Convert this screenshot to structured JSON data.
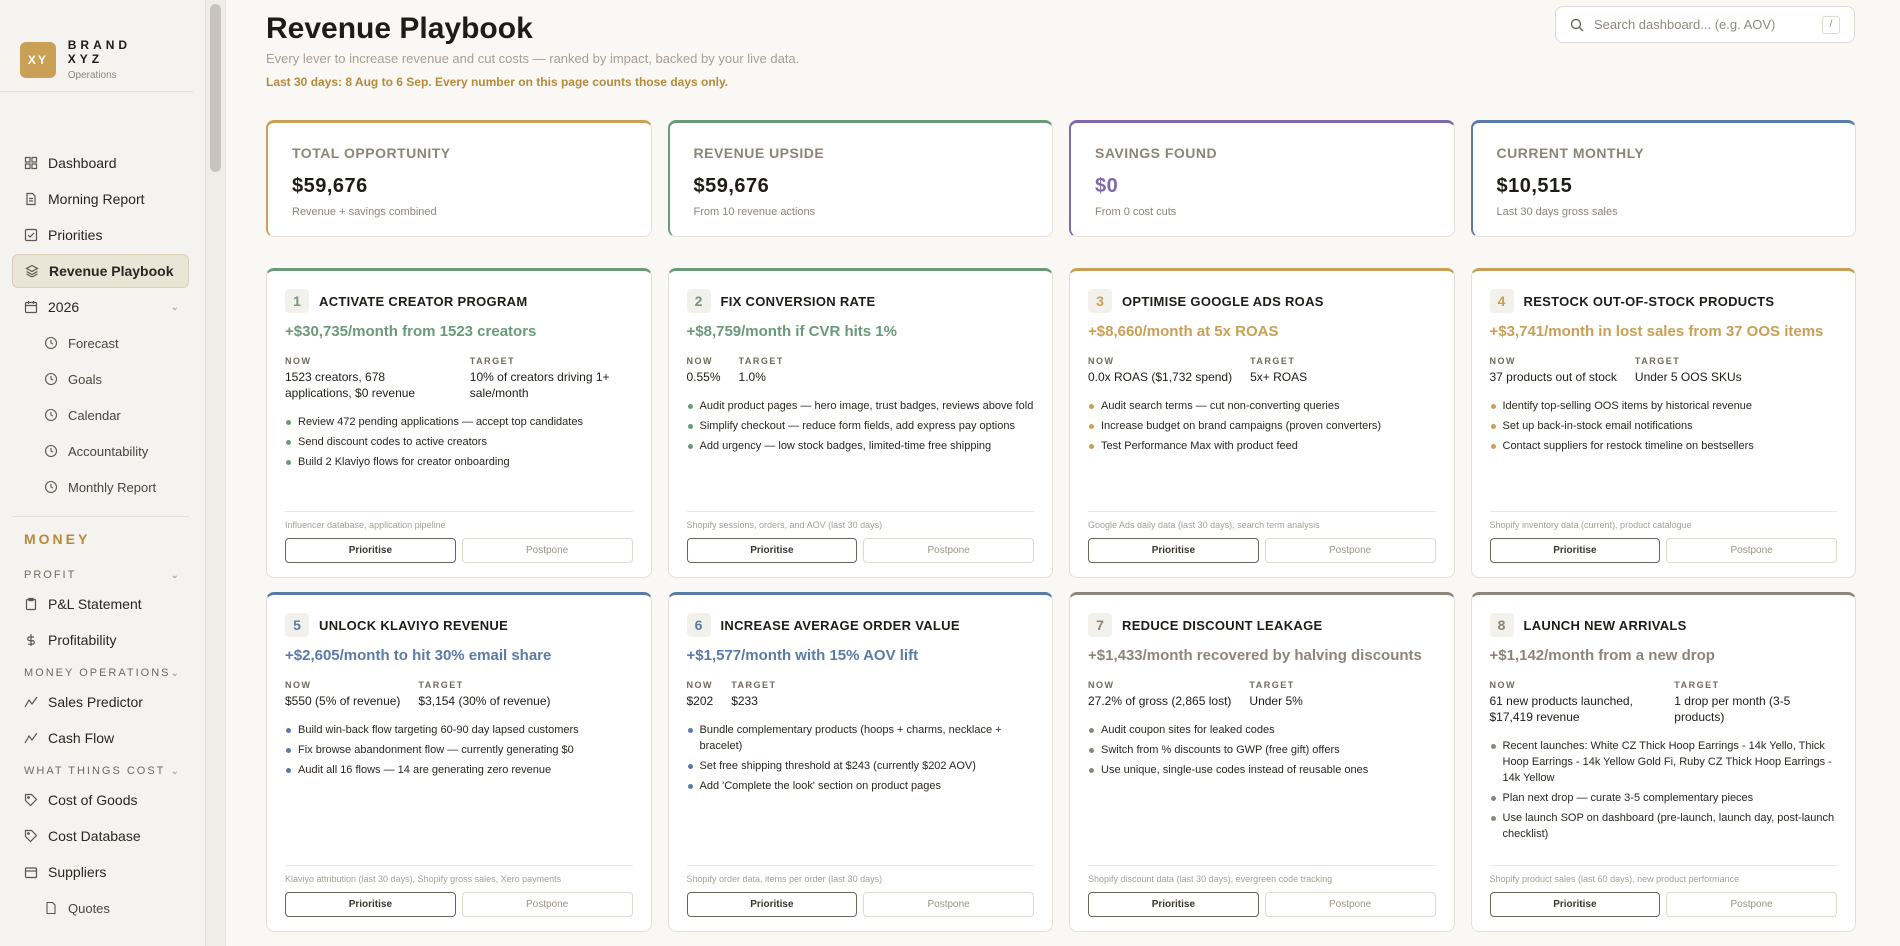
{
  "brand": {
    "logo": "XY",
    "name": "BRAND XYZ",
    "sub": "Operations"
  },
  "nav": [
    {
      "label": "Dashboard",
      "icon": "grid-icon"
    },
    {
      "label": "Morning Report",
      "icon": "document-icon"
    },
    {
      "label": "Priorities",
      "icon": "checklist-icon"
    },
    {
      "label": "Revenue Playbook",
      "icon": "layers-icon",
      "active": true
    },
    {
      "label": "2026",
      "icon": "calendar-icon",
      "expandable": true
    }
  ],
  "nav_sub": [
    {
      "label": "Forecast"
    },
    {
      "label": "Goals"
    },
    {
      "label": "Calendar"
    },
    {
      "label": "Accountability"
    },
    {
      "label": "Monthly Report"
    }
  ],
  "money": {
    "section": "MONEY",
    "groups": [
      {
        "title": "PROFIT",
        "items": [
          {
            "label": "P&L Statement",
            "icon": "clipboard-icon"
          },
          {
            "label": "Profitability",
            "icon": "dollar-icon"
          }
        ]
      },
      {
        "title": "MONEY OPERATIONS",
        "items": [
          {
            "label": "Sales Predictor",
            "icon": "trend-icon"
          },
          {
            "label": "Cash Flow",
            "icon": "trend-icon"
          }
        ]
      },
      {
        "title": "WHAT THINGS COST",
        "items": [
          {
            "label": "Cost of Goods",
            "icon": "tag-icon"
          },
          {
            "label": "Cost Database",
            "icon": "tag-icon"
          },
          {
            "label": "Suppliers",
            "icon": "box-icon"
          },
          {
            "label": "Quotes",
            "icon": "file-icon",
            "sub": true
          }
        ]
      }
    ]
  },
  "header": {
    "title": "Revenue Playbook",
    "subtitle": "Every lever to increase revenue and cut costs — ranked by impact, backed by your live data.",
    "note": "Last 30 days: 8 Aug to 6 Sep. Every number on this page counts those days only.",
    "search_placeholder": "Search dashboard... (e.g. AOV)",
    "search_shortcut": "/"
  },
  "stats": [
    {
      "label": "TOTAL OPPORTUNITY",
      "value": "$59,676",
      "hint": "Revenue + savings combined",
      "accent": "#c9a055",
      "value_color": "#1f1c17"
    },
    {
      "label": "REVENUE UPSIDE",
      "value": "$59,676",
      "hint": "From 10 revenue actions",
      "accent": "#6a9a7a",
      "value_color": "#1f1c17"
    },
    {
      "label": "SAVINGS FOUND",
      "value": "$0",
      "hint": "From 0 cost cuts",
      "accent": "#7d6aa8",
      "value_color": "#7d6aa8"
    },
    {
      "label": "CURRENT MONTHLY",
      "value": "$10,515",
      "hint": "Last 30 days gross sales",
      "accent": "#5a7aa8",
      "value_color": "#1f1c17"
    }
  ],
  "labels": {
    "now": "NOW",
    "target": "TARGET",
    "prioritise": "Prioritise",
    "postpone": "Postpone"
  },
  "levers": [
    {
      "num": "1",
      "title": "ACTIVATE CREATOR PROGRAM",
      "upside": "+$30,735/month from 1523 creators",
      "color": "#6a9a7a",
      "now": "1523 creators, 678 applications, $0 revenue",
      "target": "10% of creators driving 1+ sale/month",
      "actions": [
        "Review 472 pending applications — accept top candidates",
        "Send discount codes to active creators",
        "Build 2 Klaviyo flows for creator onboarding"
      ],
      "source": "Influencer database, application pipeline"
    },
    {
      "num": "2",
      "title": "FIX CONVERSION RATE",
      "upside": "+$8,759/month if CVR hits 1%",
      "color": "#6a9a7a",
      "now": "0.55%",
      "target": "1.0%",
      "actions": [
        "Audit product pages — hero image, trust badges, reviews above fold",
        "Simplify checkout — reduce form fields, add express pay options",
        "Add urgency — low stock badges, limited-time free shipping"
      ],
      "source": "Shopify sessions, orders, and AOV (last 30 days)"
    },
    {
      "num": "3",
      "title": "OPTIMISE GOOGLE ADS ROAS",
      "upside": "+$8,660/month at 5x ROAS",
      "color": "#c9a055",
      "now": "0.0x ROAS ($1,732 spend)",
      "target": "5x+ ROAS",
      "actions": [
        "Audit search terms — cut non-converting queries",
        "Increase budget on brand campaigns (proven converters)",
        "Test Performance Max with product feed"
      ],
      "source": "Google Ads daily data (last 30 days), search term analysis"
    },
    {
      "num": "4",
      "title": "RESTOCK OUT-OF-STOCK PRODUCTS",
      "upside": "+$3,741/month in lost sales from 37 OOS items",
      "color": "#c9a055",
      "now": "37 products out of stock",
      "target": "Under 5 OOS SKUs",
      "actions": [
        "Identify top-selling OOS items by historical revenue",
        "Set up back-in-stock email notifications",
        "Contact suppliers for restock timeline on bestsellers"
      ],
      "source": "Shopify inventory data (current), product catalogue"
    },
    {
      "num": "5",
      "title": "UNLOCK KLAVIYO REVENUE",
      "upside": "+$2,605/month to hit 30% email share",
      "color": "#5a7aa8",
      "now": "$550 (5% of revenue)",
      "target": "$3,154 (30% of revenue)",
      "actions": [
        "Build win-back flow targeting 60-90 day lapsed customers",
        "Fix browse abandonment flow — currently generating $0",
        "Audit all 16 flows — 14 are generating zero revenue"
      ],
      "source": "Klaviyo attribution (last 30 days), Shopify gross sales, Xero payments"
    },
    {
      "num": "6",
      "title": "INCREASE AVERAGE ORDER VALUE",
      "upside": "+$1,577/month with 15% AOV lift",
      "color": "#5a7aa8",
      "now": "$202",
      "target": "$233",
      "actions": [
        "Bundle complementary products (hoops + charms, necklace + bracelet)",
        "Set free shipping threshold at $243 (currently $202 AOV)",
        "Add 'Complete the look' section on product pages"
      ],
      "source": "Shopify order data, items per order (last 30 days)"
    },
    {
      "num": "7",
      "title": "REDUCE DISCOUNT LEAKAGE",
      "upside": "+$1,433/month recovered by halving discounts",
      "color": "#8c857a",
      "now": "27.2% of gross (2,865 lost)",
      "target": "Under 5%",
      "actions": [
        "Audit coupon sites for leaked codes",
        "Switch from % discounts to GWP (free gift) offers",
        "Use unique, single-use codes instead of reusable ones"
      ],
      "source": "Shopify discount data (last 30 days), evergreen code tracking"
    },
    {
      "num": "8",
      "title": "LAUNCH NEW ARRIVALS",
      "upside": "+$1,142/month from a new drop",
      "color": "#8c857a",
      "now": "61 new products launched, $17,419 revenue",
      "target": "1 drop per month (3-5 products)",
      "actions": [
        "Recent launches: White CZ Thick Hoop Earrings - 14k Yello, Thick Hoop Earrings - 14k Yellow Gold Fi, Ruby CZ Thick Hoop Earrings - 14k Yellow",
        "Plan next drop — curate 3-5 complementary pieces",
        "Use launch SOP on dashboard (pre-launch, launch day, post-launch checklist)"
      ],
      "source": "Shopify product sales (last 60 days), new product performance"
    }
  ]
}
